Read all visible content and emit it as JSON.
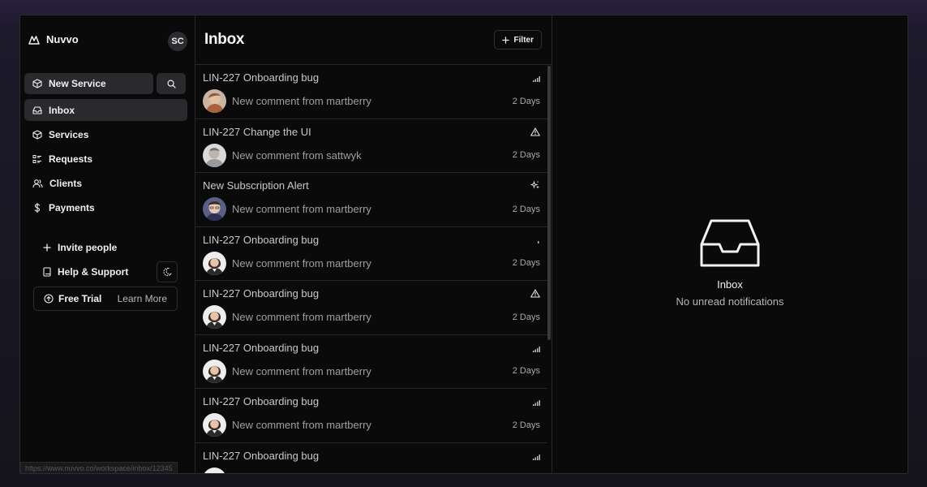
{
  "app": {
    "name": "Nuvvo",
    "user_initials": "SC"
  },
  "sidebar": {
    "new_service_label": "New Service",
    "nav": [
      {
        "label": "Inbox",
        "icon": "inbox-icon",
        "active": true
      },
      {
        "label": "Services",
        "icon": "box-icon",
        "active": false
      },
      {
        "label": "Requests",
        "icon": "list-icon",
        "active": false
      },
      {
        "label": "Clients",
        "icon": "users-icon",
        "active": false
      },
      {
        "label": "Payments",
        "icon": "dollar-icon",
        "active": false
      }
    ],
    "invite_label": "Invite people",
    "help_label": "Help & Support",
    "trial_label": "Free Trial",
    "learn_more_label": "Learn More"
  },
  "status_url": "https://www.nuvvo.co/workspace/inbox/12345",
  "inbox": {
    "title": "Inbox",
    "filter_label": "Filter",
    "items": [
      {
        "title": "LIN-227 Onboarding bug",
        "message": "New comment from martberry",
        "time": "2 Days",
        "indicator": "priority-bars-icon",
        "avatar": "avatar-1"
      },
      {
        "title": "LIN-227 Change the UI",
        "message": "New comment from sattwyk",
        "time": "2 Days",
        "indicator": "warning-icon",
        "avatar": "avatar-2"
      },
      {
        "title": "New Subscription Alert",
        "message": "New comment from martberry",
        "time": "2 Days",
        "indicator": "sparkle-icon",
        "avatar": "avatar-3"
      },
      {
        "title": "LIN-227 Onboarding bug",
        "message": "New comment from martberry",
        "time": "2 Days",
        "indicator": "priority-low-icon",
        "avatar": "avatar-4"
      },
      {
        "title": "LIN-227 Onboarding bug",
        "message": "New comment from martberry",
        "time": "2 Days",
        "indicator": "warning-icon",
        "avatar": "avatar-4"
      },
      {
        "title": "LIN-227 Onboarding bug",
        "message": "New comment from martberry",
        "time": "2 Days",
        "indicator": "priority-bars-icon",
        "avatar": "avatar-4"
      },
      {
        "title": "LIN-227 Onboarding bug",
        "message": "New comment from martberry",
        "time": "2 Days",
        "indicator": "priority-bars-icon",
        "avatar": "avatar-4"
      },
      {
        "title": "LIN-227 Onboarding bug",
        "message": "",
        "time": "",
        "indicator": "priority-bars-icon",
        "avatar": "avatar-4"
      }
    ]
  },
  "detail": {
    "empty_title": "Inbox",
    "empty_subtitle": "No unread notifications"
  }
}
